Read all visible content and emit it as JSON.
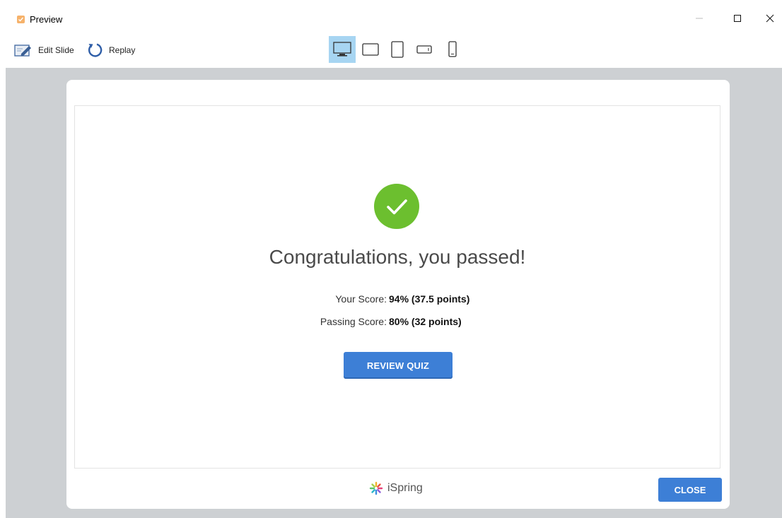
{
  "window": {
    "title": "Preview"
  },
  "toolbar": {
    "edit_label": "Edit Slide",
    "replay_label": "Replay",
    "devices": [
      {
        "icon": "desktop-icon",
        "active": true
      },
      {
        "icon": "tablet-landscape-icon",
        "active": false
      },
      {
        "icon": "tablet-portrait-icon",
        "active": false
      },
      {
        "icon": "phone-landscape-icon",
        "active": false
      },
      {
        "icon": "phone-portrait-icon",
        "active": false
      }
    ]
  },
  "result": {
    "headline": "Congratulations, you passed!",
    "your_score_label": "Your Score:",
    "your_score_value": "94% (37.5 points)",
    "passing_score_label": "Passing Score:",
    "passing_score_value": "80% (32 points)",
    "review_button": "REVIEW QUIZ"
  },
  "footer": {
    "brand": "iSpring",
    "close_button": "CLOSE"
  },
  "colors": {
    "accent": "#3d7fd6",
    "success": "#6cbf2f",
    "backdrop": "#cdd0d3",
    "device_active": "#a7d5f2"
  }
}
